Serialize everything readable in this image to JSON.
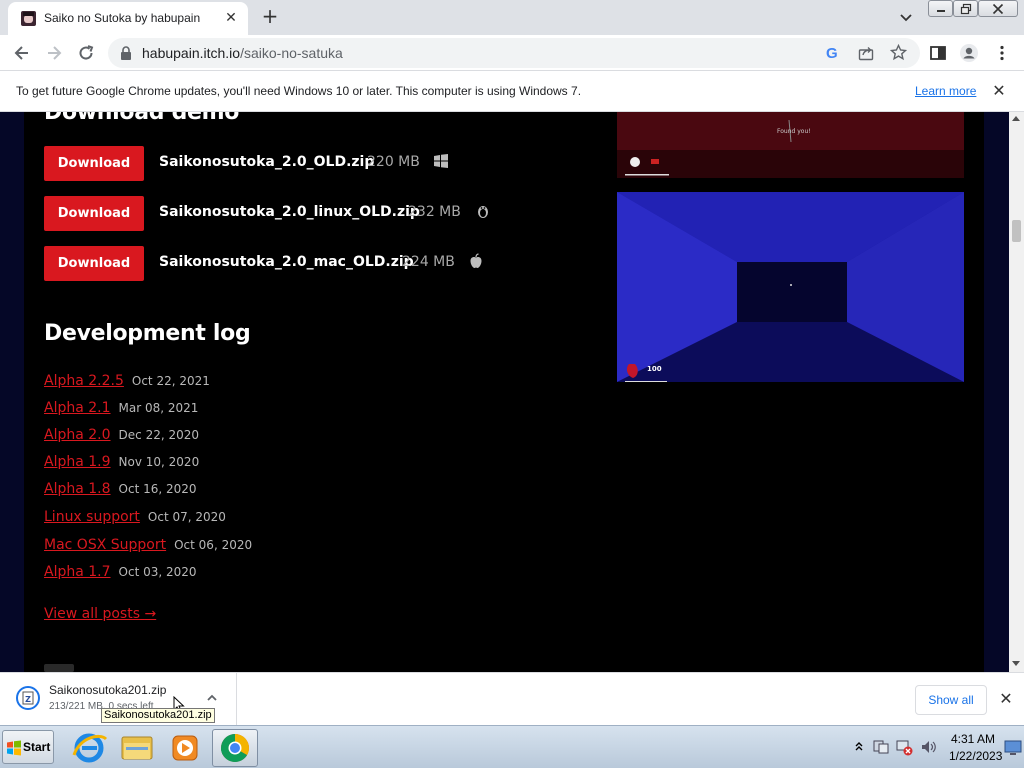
{
  "browser": {
    "tab": {
      "title": "Saiko no Sutoka by habupain"
    },
    "address": {
      "host": "habupain.itch.io",
      "path": "/saiko-no-satuka"
    },
    "google_letter": "G"
  },
  "infobar": {
    "message": "To get future Google Chrome updates, you'll need Windows 10 or later. This computer is using Windows 7.",
    "link": "Learn more"
  },
  "page": {
    "download_section_title": "Download demo",
    "downloads": [
      {
        "button": "Download",
        "filename": "Saikonosutoka_2.0_OLD.zip",
        "size": "220 MB",
        "os_icon": "windows-icon"
      },
      {
        "button": "Download",
        "filename": "Saikonosutoka_2.0_linux_OLD.zip",
        "size": "232 MB",
        "os_icon": "linux-icon"
      },
      {
        "button": "Download",
        "filename": "Saikonosutoka_2.0_mac_OLD.zip",
        "size": "224 MB",
        "os_icon": "apple-icon"
      }
    ],
    "devlog_title": "Development log",
    "devlog": [
      {
        "title": "Alpha 2.2.5",
        "date": "Oct 22, 2021"
      },
      {
        "title": "Alpha 2.1",
        "date": "Mar 08, 2021"
      },
      {
        "title": "Alpha 2.0",
        "date": "Dec 22, 2020"
      },
      {
        "title": "Alpha 1.9",
        "date": "Nov 10, 2020"
      },
      {
        "title": "Alpha 1.8",
        "date": "Oct 16, 2020"
      },
      {
        "title": "Linux support",
        "date": "Oct 07, 2020"
      },
      {
        "title": "Mac OSX Support",
        "date": "Oct 06, 2020"
      },
      {
        "title": "Alpha 1.7",
        "date": "Oct 03, 2020"
      }
    ],
    "view_all": "View all posts",
    "view_all_arrow": "→",
    "screenshot1_caption": "Found you!",
    "screenshot2_hud": "100",
    "accent_color": "#d9181f"
  },
  "download_shelf": {
    "filename": "Saikonosutoka201.zip",
    "status": "213/221 MB, 0 secs left",
    "tooltip": "Saikonosutoka201.zip",
    "show_all": "Show all"
  },
  "taskbar": {
    "start": "Start",
    "apps": [
      "internet-explorer-icon",
      "windows-explorer-icon",
      "media-player-icon",
      "chrome-icon"
    ],
    "time": "4:31 AM",
    "date": "1/22/2023"
  }
}
